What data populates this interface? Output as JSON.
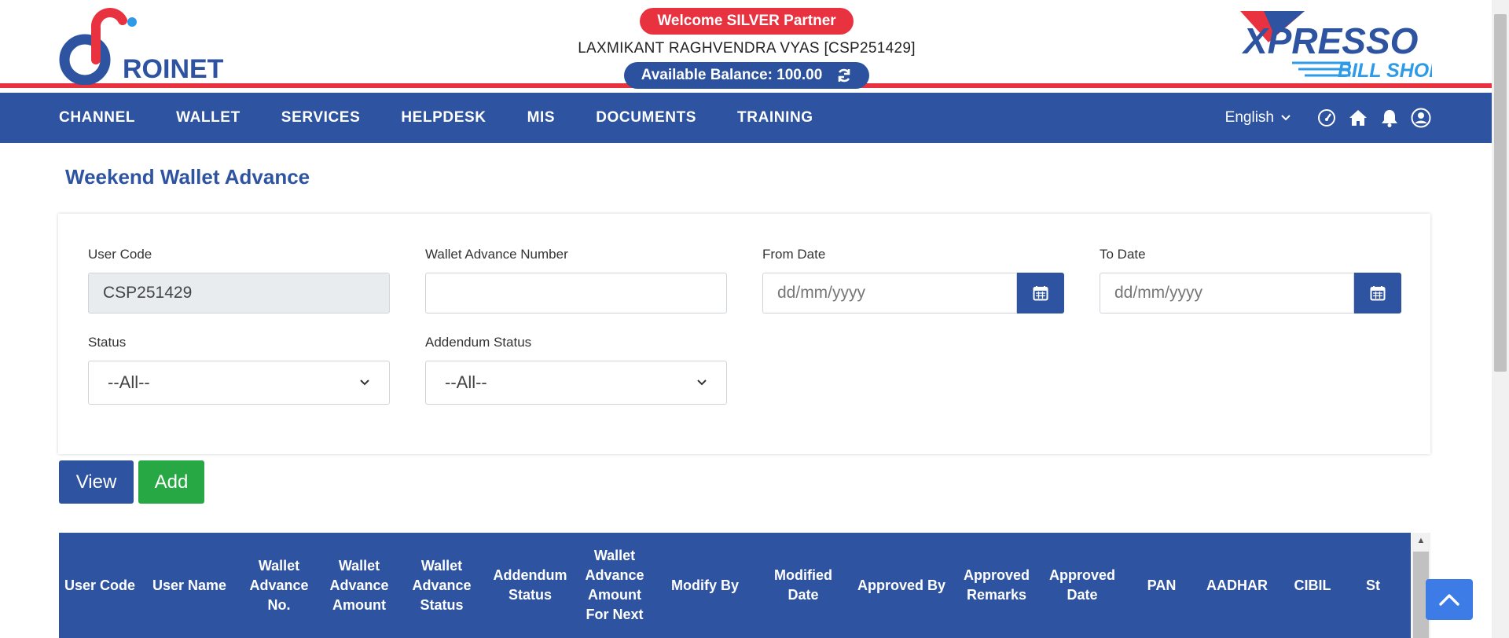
{
  "header": {
    "left_logo_text": "ROINET",
    "right_logo_text_1": "XPRESSO",
    "right_logo_text_2": "BILL SHOP",
    "welcome": "Welcome SILVER Partner",
    "user_line": "LAXMIKANT RAGHVENDRA VYAS [CSP251429]",
    "balance_label": "Available Balance: 100.00",
    "colors": {
      "brand_blue": "#2e53a0",
      "brand_red": "#e8323f",
      "add_green": "#28a745"
    }
  },
  "nav": {
    "items": [
      "CHANNEL",
      "WALLET",
      "SERVICES",
      "HELPDESK",
      "MIS",
      "DOCUMENTS",
      "TRAINING"
    ],
    "language": "English",
    "icons": [
      "dashboard-gauge-icon",
      "home-icon",
      "bell-icon",
      "user-circle-icon"
    ]
  },
  "page": {
    "title": "Weekend Wallet Advance"
  },
  "filters": {
    "user_code_label": "User Code",
    "user_code_value": "CSP251429",
    "wallet_advance_number_label": "Wallet Advance Number",
    "wallet_advance_number_value": "",
    "from_date_label": "From Date",
    "from_date_placeholder": "dd/mm/yyyy",
    "to_date_label": "To Date",
    "to_date_placeholder": "dd/mm/yyyy",
    "status_label": "Status",
    "status_value": "--All--",
    "addendum_status_label": "Addendum Status",
    "addendum_status_value": "--All--"
  },
  "buttons": {
    "view": "View",
    "add": "Add"
  },
  "table": {
    "headers": [
      "User Code",
      "User Name",
      "Wallet Advance No.",
      "Wallet Advance Amount",
      "Wallet Advance Status",
      "Addendum Status",
      "Wallet Advance Amount For Next",
      "Modify By",
      "Modified Date",
      "Approved By",
      "Approved Remarks",
      "Approved Date",
      "PAN",
      "AADHAR",
      "CIBIL",
      "St"
    ]
  }
}
